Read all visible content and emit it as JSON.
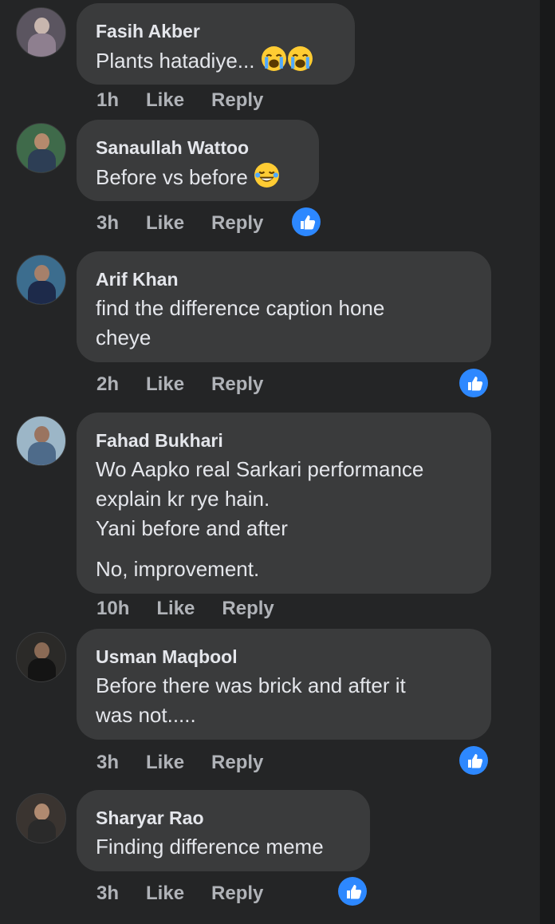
{
  "comments": [
    {
      "name": "Fasih Akber",
      "text": [
        "Plants hatadiye... "
      ],
      "emojis": [
        "😭",
        "😭"
      ],
      "time": "1h",
      "like_label": "Like",
      "reply_label": "Reply",
      "has_like_reaction": false
    },
    {
      "name": "Sanaullah Wattoo",
      "text": [
        "Before vs before "
      ],
      "emojis": [
        "😂"
      ],
      "time": "3h",
      "like_label": "Like",
      "reply_label": "Reply",
      "has_like_reaction": true
    },
    {
      "name": "Arif Khan",
      "text": [
        "find the difference caption hone",
        "cheye"
      ],
      "time": "2h",
      "like_label": "Like",
      "reply_label": "Reply",
      "has_like_reaction": true
    },
    {
      "name": "Fahad Bukhari",
      "text": [
        "Wo Aapko real Sarkari performance",
        "explain kr rye hain.",
        "Yani before and after",
        "No, improvement."
      ],
      "time": "10h",
      "like_label": "Like",
      "reply_label": "Reply",
      "has_like_reaction": false
    },
    {
      "name": "Usman Maqbool",
      "text": [
        "Before there was brick and after it",
        "was not....."
      ],
      "time": "3h",
      "like_label": "Like",
      "reply_label": "Reply",
      "has_like_reaction": true
    },
    {
      "name": "Sharyar Rao",
      "text": [
        "Finding difference meme"
      ],
      "time": "3h",
      "like_label": "Like",
      "reply_label": "Reply",
      "has_like_reaction": true
    }
  ],
  "colors": {
    "background": "#242526",
    "bubble": "#3a3b3c",
    "name": "#e4e6eb",
    "text": "#e4e6eb",
    "meta": "#b0b3b8",
    "like_badge": "#2d88ff"
  },
  "icons": {
    "reaction": "like-thumb-icon",
    "crying": "loudly-crying-face-icon",
    "laughing": "tears-of-joy-face-icon"
  }
}
